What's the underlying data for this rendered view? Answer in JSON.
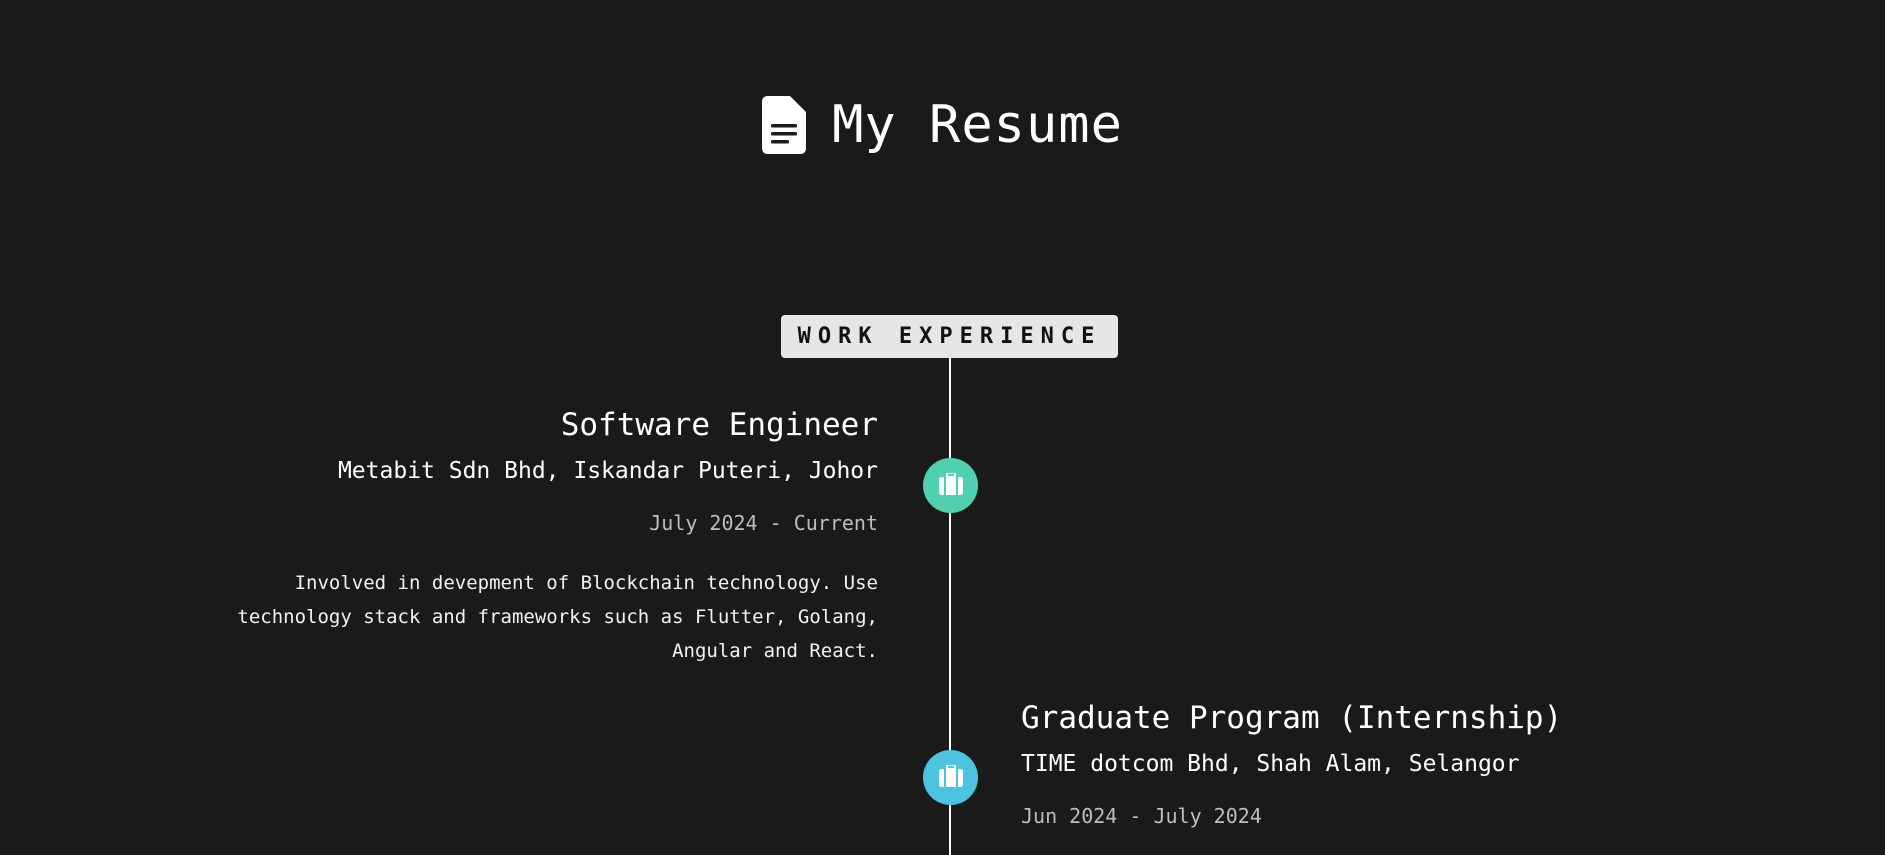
{
  "header": {
    "icon": "file-document-icon",
    "title": "My Resume"
  },
  "section": {
    "label": "WORK EXPERIENCE"
  },
  "timeline": {
    "line_color": "#ffffff",
    "entries": [
      {
        "title": "Software Engineer",
        "company": "Metabit Sdn Bhd, Iskandar Puteri, Johor",
        "date": "July 2024 - Current",
        "description": "Involved in devepment of Blockchain technology. Use technology stack and frameworks such as Flutter, Golang, Angular and React.",
        "icon": "briefcase-icon",
        "marker_color": "#4fd1b0"
      },
      {
        "title": "Graduate Program (Internship)",
        "company": "TIME dotcom Bhd, Shah Alam, Selangor",
        "date": "Jun 2024 - July 2024",
        "icon": "briefcase-icon",
        "marker_color": "#4cc3df"
      }
    ]
  },
  "colors": {
    "background": "#1a1a1a",
    "badge_background": "#e6e6e6",
    "badge_text": "#111111"
  }
}
